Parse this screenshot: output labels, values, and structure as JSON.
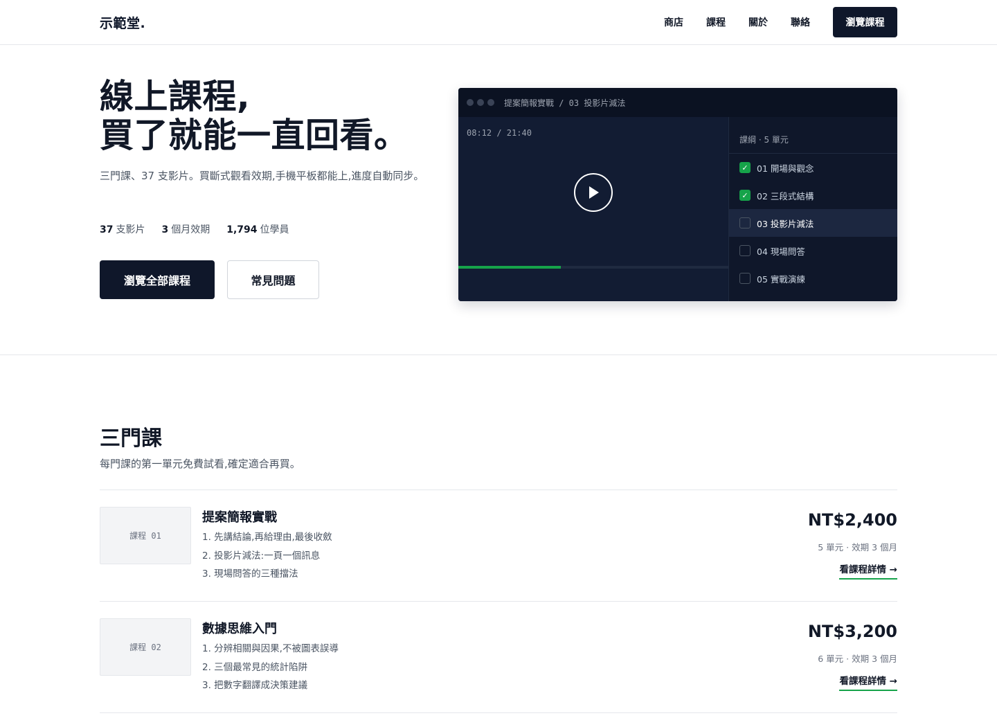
{
  "header": {
    "logo": "示範堂.",
    "nav": [
      "商店",
      "課程",
      "關於",
      "聯絡"
    ],
    "cta": "瀏覽課程"
  },
  "hero": {
    "title_line1": "線上課程,",
    "title_line2": "買了就能一直回看。",
    "subtitle": "三門課、37 支影片。買斷式觀看效期,手機平板都能上,進度自動同步。",
    "stats": [
      {
        "value": "37",
        "label": "支影片"
      },
      {
        "value": "3",
        "label": "個月效期"
      },
      {
        "value": "1,794",
        "label": "位學員"
      }
    ],
    "primary_button": "瀏覽全部課程",
    "secondary_button": "常見問題"
  },
  "player": {
    "breadcrumb": "提案簡報實戰 / 03 投影片減法",
    "timecode": "08:12 / 21:40",
    "progress": 0.38,
    "outline_heading": "課綱 · 5 單元",
    "lessons": [
      {
        "label": "01 開場與觀念",
        "done": true,
        "active": false
      },
      {
        "label": "02 三段式結構",
        "done": true,
        "active": false
      },
      {
        "label": "03 投影片減法",
        "done": false,
        "active": true
      },
      {
        "label": "04 現場問答",
        "done": false,
        "active": false
      },
      {
        "label": "05 實戰演練",
        "done": false,
        "active": false
      }
    ],
    "colors": {
      "accent": "#16a34a",
      "panel": "#0f172a"
    }
  },
  "courses": {
    "title": "三門課",
    "subtitle": "每門課的第一單元免費試看,確定適合再買。",
    "items": [
      {
        "thumb": "課程 01",
        "title": "提案簡報實戰",
        "points": [
          "1. 先講結論,再給理由,最後收斂",
          "2. 投影片減法:一頁一個訊息",
          "3. 現場問答的三種擋法"
        ],
        "price": "NT$2,400",
        "meta": "5 單元 · 效期 3 個月",
        "link": "看課程詳情 →"
      },
      {
        "thumb": "課程 02",
        "title": "數據思維入門",
        "points": [
          "1. 分辨相關與因果,不被圖表誤導",
          "2. 三個最常見的統計陷阱",
          "3. 把數字翻譯成決策建議"
        ],
        "price": "NT$3,200",
        "meta": "6 單元 · 效期 3 個月",
        "link": "看課程詳情 →"
      }
    ]
  }
}
